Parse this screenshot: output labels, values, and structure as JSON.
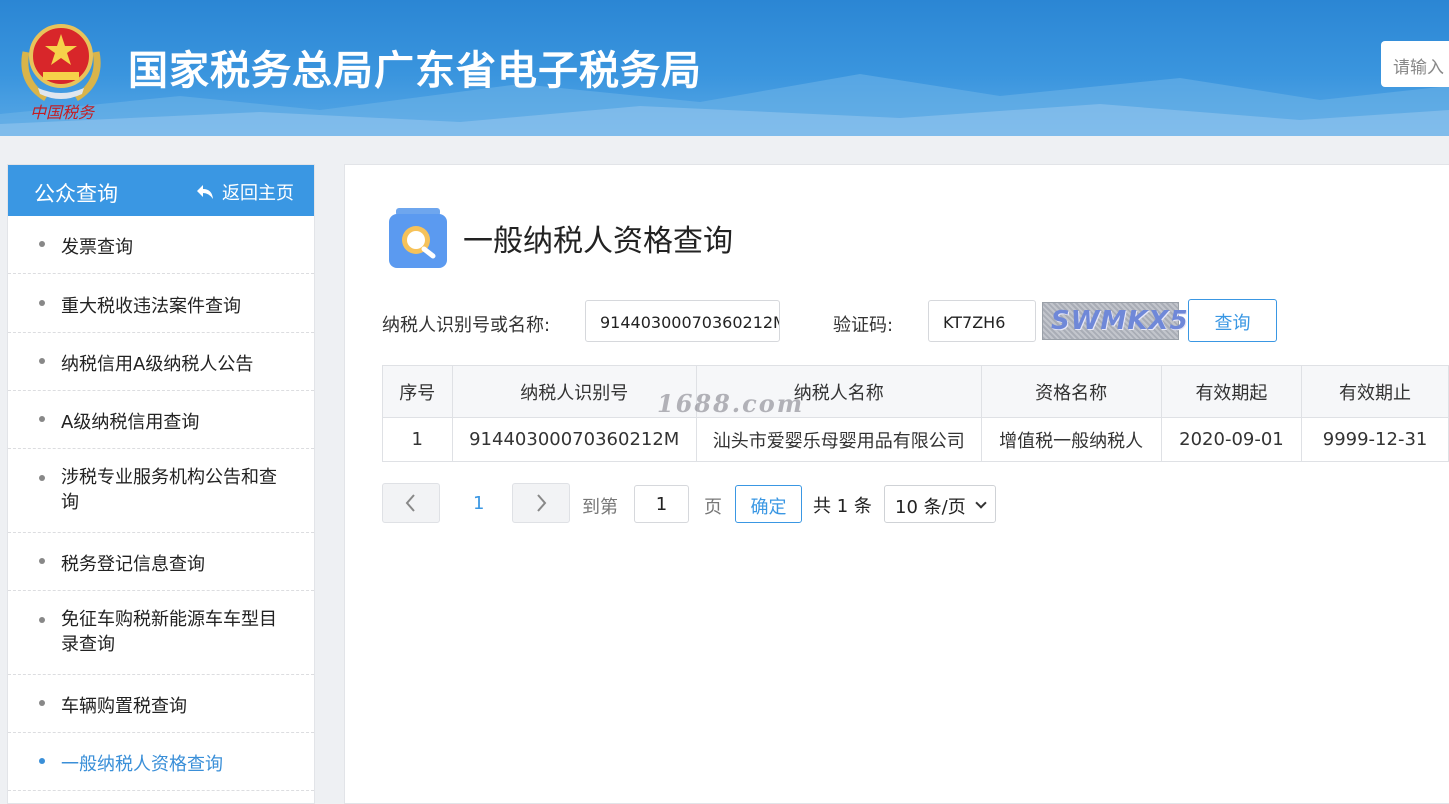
{
  "header": {
    "site_title": "国家税务总局广东省电子税务局",
    "search_placeholder": "请输入"
  },
  "sidebar": {
    "title": "公众查询",
    "back_label": "返回主页",
    "items": [
      {
        "label": "发票查询"
      },
      {
        "label": "重大税收违法案件查询"
      },
      {
        "label": "纳税信用A级纳税人公告"
      },
      {
        "label": "A级纳税信用查询"
      },
      {
        "label": "涉税专业服务机构公告和查询"
      },
      {
        "label": "税务登记信息查询"
      },
      {
        "label": "免征车购税新能源车车型目录查询"
      },
      {
        "label": "车辆购置税查询"
      },
      {
        "label": "一般纳税人资格查询",
        "active": true
      }
    ]
  },
  "main": {
    "page_title": "一般纳税人资格查询",
    "form": {
      "taxpayer_label": "纳税人识别号或名称:",
      "taxpayer_value": "91440300070360212M",
      "captcha_label": "验证码:",
      "captcha_value": "KT7ZH6",
      "captcha_image_text": "SWMKX5",
      "query_button": "查询"
    },
    "table": {
      "columns": [
        "序号",
        "纳税人识别号",
        "纳税人名称",
        "资格名称",
        "有效期起",
        "有效期止"
      ],
      "rows": [
        [
          "1",
          "91440300070360212M",
          "汕头市爱婴乐母婴用品有限公司",
          "增值税一般纳税人",
          "2020-09-01",
          "9999-12-31"
        ]
      ]
    },
    "watermark": "1688.com",
    "pagination": {
      "current_page": "1",
      "goto_label": "到第",
      "goto_value": "1",
      "page_suffix": "页",
      "confirm_button": "确定",
      "total_text": "共 1 条",
      "page_size": "10 条/页"
    }
  },
  "colors": {
    "accent": "#3a97e3",
    "header_bg": "#2b86d4"
  }
}
